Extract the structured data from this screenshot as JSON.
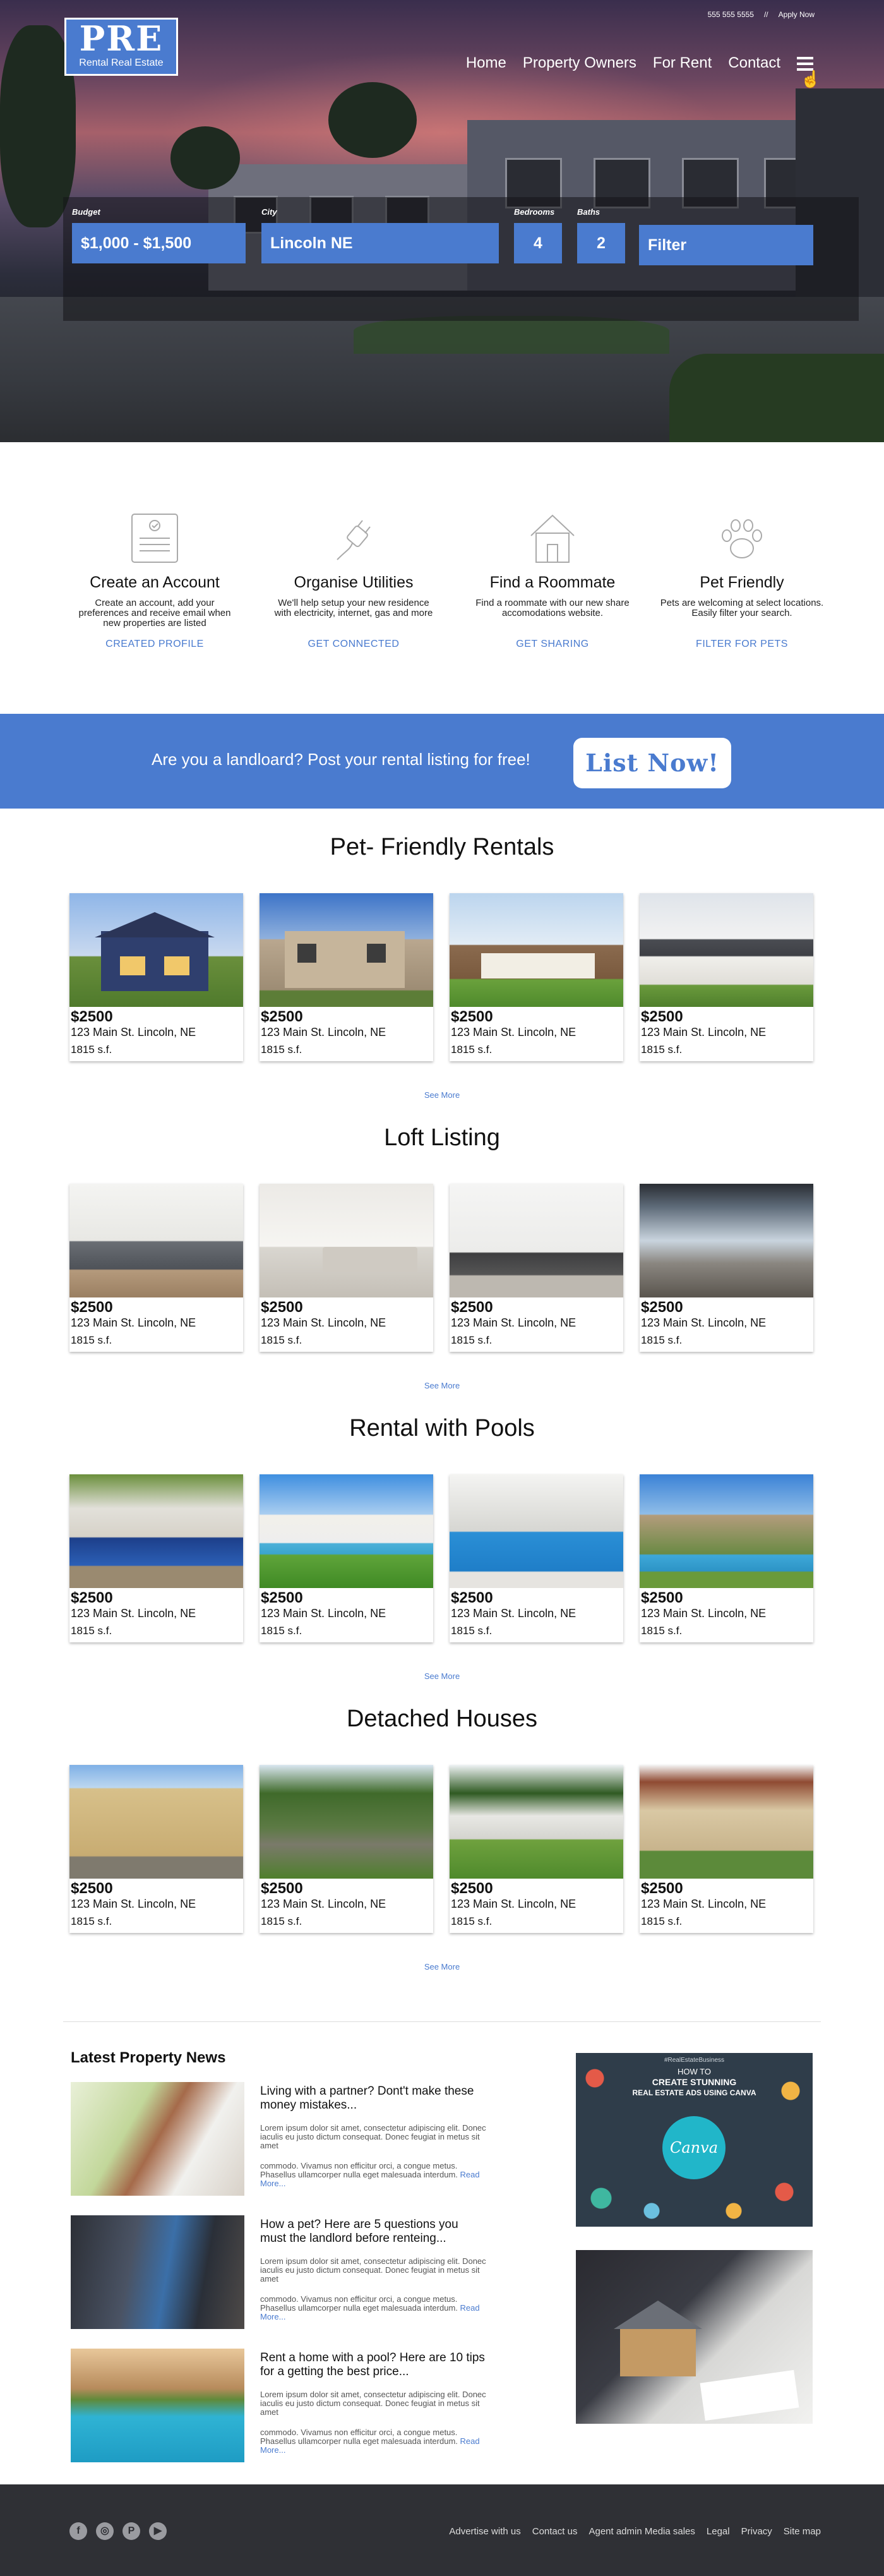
{
  "header": {
    "phone": "555 555 5555",
    "separator": "//",
    "apply": "Apply Now",
    "logo_big": "PRE",
    "logo_small": "Rental Real Estate",
    "nav": [
      "Home",
      "Property Owners",
      "For Rent",
      "Contact"
    ]
  },
  "search": {
    "budget_label": "Budget",
    "budget_value": "$1,000 - $1,500",
    "city_label": "City",
    "city_value": "Lincoln NE",
    "bedrooms_label": "Bedrooms",
    "bedrooms_value": "4",
    "baths_label": "Baths",
    "baths_value": "2",
    "filter_label": "Filter"
  },
  "features": [
    {
      "title": "Create an Account",
      "text": "Create an account, add your preferences and receive email when new properties are listed",
      "link": "CREATED PROFILE",
      "icon": "checklist-icon"
    },
    {
      "title": "Organise Utilities",
      "text": "We'll help setup your new residence with electricity, internet, gas and more",
      "link": "GET CONNECTED",
      "icon": "plug-icon"
    },
    {
      "title": "Find a Roommate",
      "text": "Find a roommate with our new share accomodations website.",
      "link": "GET SHARING",
      "icon": "house-icon"
    },
    {
      "title": "Pet Friendly",
      "text": "Pets are welcoming at select locations. Easily filter your search.",
      "link": "FILTER FOR PETS",
      "icon": "paw-icon"
    }
  ],
  "banner": {
    "text": "Are you a landloard? Post your rental listing for free!",
    "button": "List Now!"
  },
  "listings": [
    {
      "title": "Pet- Friendly Rentals",
      "see_more": "See More",
      "cards": [
        {
          "price": "$2500",
          "address": "123 Main St. Lincoln, NE",
          "size": "1815 s.f."
        },
        {
          "price": "$2500",
          "address": "123 Main St. Lincoln, NE",
          "size": "1815 s.f."
        },
        {
          "price": "$2500",
          "address": "123 Main St. Lincoln, NE",
          "size": "1815 s.f."
        },
        {
          "price": "$2500",
          "address": "123 Main St. Lincoln, NE",
          "size": "1815 s.f."
        }
      ]
    },
    {
      "title": "Loft Listing",
      "see_more": "See More",
      "cards": [
        {
          "price": "$2500",
          "address": "123 Main St. Lincoln, NE",
          "size": "1815 s.f."
        },
        {
          "price": "$2500",
          "address": "123 Main St. Lincoln, NE",
          "size": "1815 s.f."
        },
        {
          "price": "$2500",
          "address": "123 Main St. Lincoln, NE",
          "size": "1815 s.f."
        },
        {
          "price": "$2500",
          "address": "123 Main St. Lincoln, NE",
          "size": "1815 s.f."
        }
      ]
    },
    {
      "title": "Rental with Pools",
      "see_more": "See More",
      "cards": [
        {
          "price": "$2500",
          "address": "123 Main St. Lincoln, NE",
          "size": "1815 s.f."
        },
        {
          "price": "$2500",
          "address": "123 Main St. Lincoln, NE",
          "size": "1815 s.f."
        },
        {
          "price": "$2500",
          "address": "123 Main St. Lincoln, NE",
          "size": "1815 s.f."
        },
        {
          "price": "$2500",
          "address": "123 Main St. Lincoln, NE",
          "size": "1815 s.f."
        }
      ]
    },
    {
      "title": "Detached Houses",
      "see_more": "See More",
      "cards": [
        {
          "price": "$2500",
          "address": "123 Main St. Lincoln, NE",
          "size": "1815 s.f."
        },
        {
          "price": "$2500",
          "address": "123 Main St. Lincoln, NE",
          "size": "1815 s.f."
        },
        {
          "price": "$2500",
          "address": "123 Main St. Lincoln, NE",
          "size": "1815 s.f."
        },
        {
          "price": "$2500",
          "address": "123 Main St. Lincoln, NE",
          "size": "1815 s.f."
        }
      ]
    }
  ],
  "news": {
    "title": "Latest Property News",
    "items": [
      {
        "headline": "Living with a partner? Dont't make these money mistakes...",
        "excerpt1": "Lorem ipsum dolor sit amet, consectetur adipiscing elit. Donec iaculis eu justo dictum consequat. Donec feugiat in metus sit amet",
        "excerpt2": "commodo. Vivamus non efficitur orci, a congue metus. Phasellus ullamcorper nulla eget malesuada interdum.",
        "read_more": "Read More..."
      },
      {
        "headline": "How a pet? Here are 5 questions you must the landlord before renteing...",
        "excerpt1": "Lorem ipsum dolor sit amet, consectetur adipiscing elit. Donec iaculis eu justo dictum consequat. Donec feugiat in metus sit amet",
        "excerpt2": "commodo. Vivamus non efficitur orci, a congue metus. Phasellus ullamcorper nulla eget malesuada interdum.",
        "read_more": "Read More..."
      },
      {
        "headline": "Rent a home with a pool? Here are 10 tips for a getting the best price...",
        "excerpt1": "Lorem ipsum dolor sit amet, consectetur adipiscing elit. Donec iaculis eu justo dictum consequat. Donec feugiat in metus sit amet",
        "excerpt2": "commodo. Vivamus non efficitur orci, a congue metus. Phasellus ullamcorper nulla eget malesuada interdum.",
        "read_more": "Read More..."
      }
    ],
    "ad1": {
      "tag": "#RealEstateBusiness",
      "line1": "HOW TO",
      "line2": "CREATE STUNNING",
      "line3": "REAL ESTATE ADS USING CANVA",
      "brand": "Canva"
    }
  },
  "footer": {
    "social": [
      "f",
      "◎",
      "P",
      "▶"
    ],
    "links": [
      "Advertise with us",
      "Contact us",
      "Agent admin Media sales",
      "Legal",
      "Privacy",
      "Site map"
    ]
  }
}
